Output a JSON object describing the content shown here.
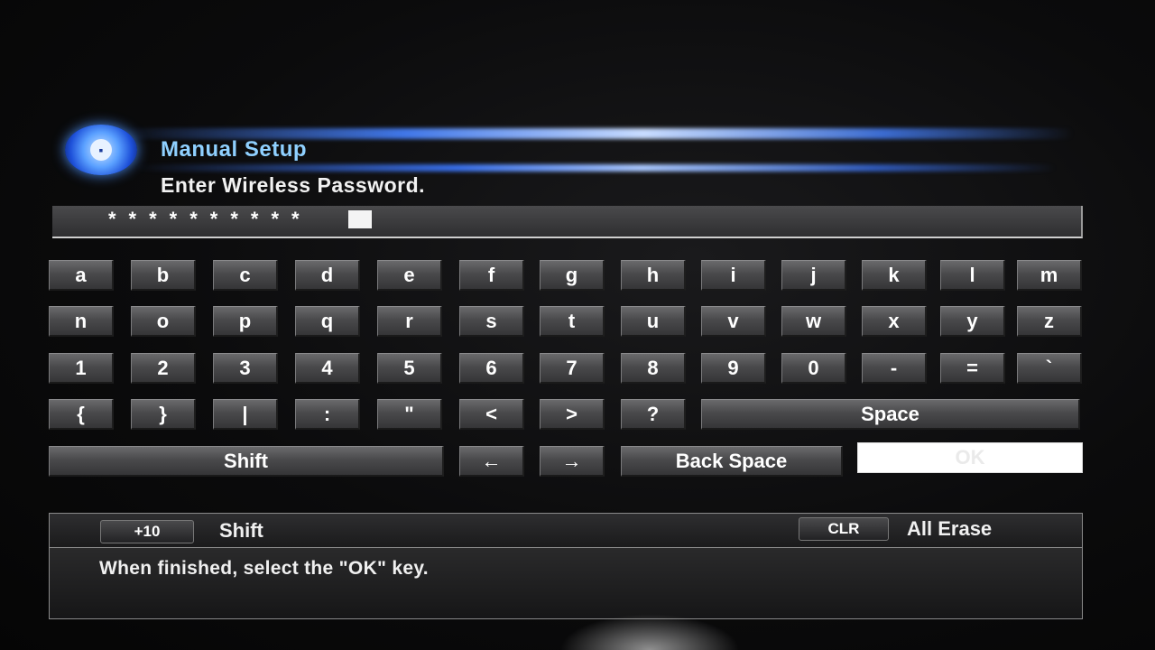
{
  "header": {
    "title": "Manual Setup",
    "subtitle": "Enter Wireless Password."
  },
  "password_field": {
    "masked_value": "**********"
  },
  "keyboard": {
    "row1": [
      "a",
      "b",
      "c",
      "d",
      "e",
      "f",
      "g",
      "h",
      "i",
      "j",
      "k",
      "l",
      "m"
    ],
    "row2": [
      "n",
      "o",
      "p",
      "q",
      "r",
      "s",
      "t",
      "u",
      "v",
      "w",
      "x",
      "y",
      "z"
    ],
    "row3": [
      "1",
      "2",
      "3",
      "4",
      "5",
      "6",
      "7",
      "8",
      "9",
      "0",
      "-",
      "=",
      "`"
    ],
    "row4": [
      "{",
      "}",
      "|",
      ":",
      "\"",
      "<",
      ">",
      "?"
    ],
    "space_label": "Space",
    "shift_label": "Shift",
    "left_arrow": "←",
    "right_arrow": "→",
    "backspace_label": "Back Space",
    "ok_label": "OK"
  },
  "help_bar": {
    "plus10_chip": "+10",
    "plus10_action": "Shift",
    "clr_chip": "CLR",
    "clr_action": "All Erase"
  },
  "message": "When finished, select the \"OK\" key.",
  "icons": {
    "title_icon": "network-disc-icon"
  }
}
